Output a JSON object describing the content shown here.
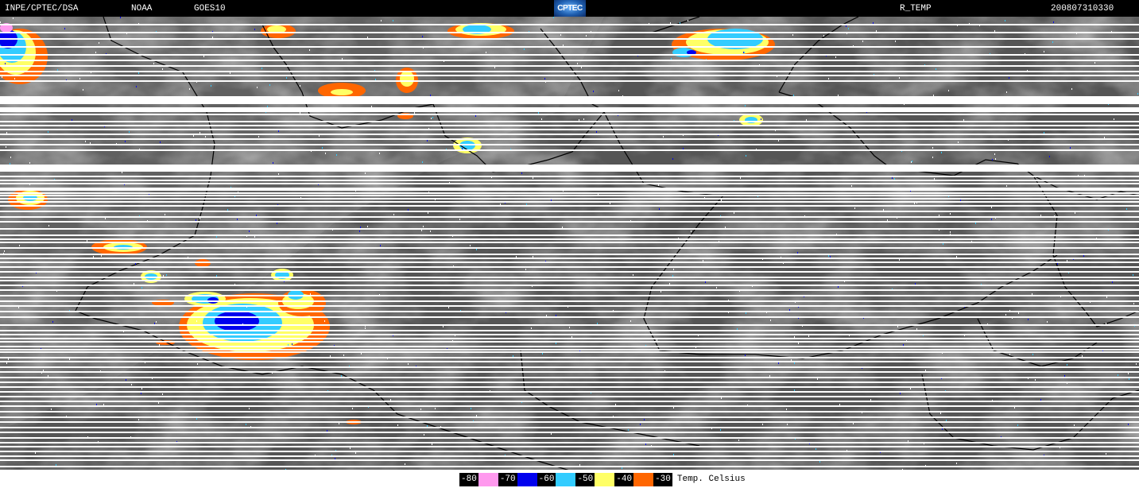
{
  "header": {
    "source": "INPE/CPTEC/DSA",
    "agency": "NOAA",
    "satellite": "GOES10",
    "logo_text": "CPTEC",
    "product": "R_TEMP",
    "datetime": "200807310330"
  },
  "map": {
    "background_color": "#555555",
    "border_color": "#000000"
  },
  "legend": {
    "items": [
      {
        "label": "-80",
        "color": "#ff99ee"
      },
      {
        "label": "-70",
        "color": "#0000ee"
      },
      {
        "label": "-60",
        "color": "#33ccff"
      },
      {
        "label": "-50",
        "color": "#ffff66"
      },
      {
        "label": "-40",
        "color": "#ff6600"
      },
      {
        "label": "-30",
        "color": "#555555"
      }
    ],
    "unit": "Temp. Celsius"
  }
}
